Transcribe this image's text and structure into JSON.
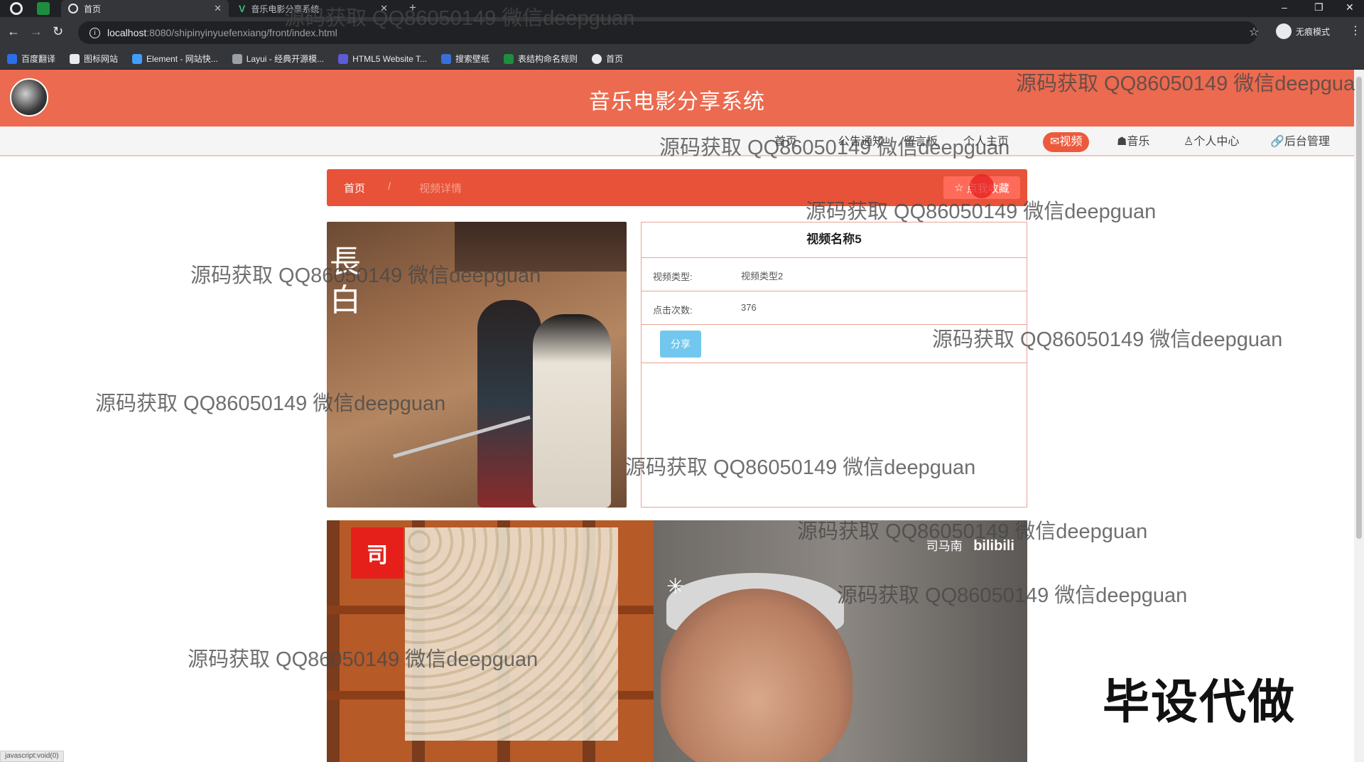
{
  "browser": {
    "tabs": [
      {
        "label": "首页",
        "active": true
      },
      {
        "label": "音乐电影分享系统",
        "active": false
      }
    ],
    "url_host": "localhost",
    "url_path": ":8080/shipinyinyuefenxiang/front/index.html",
    "profile_label": "无痕模式",
    "bookmarks": [
      {
        "label": "百度翻译",
        "color": "#2a6ee8"
      },
      {
        "label": "图标网站",
        "color": "#e8eaed"
      },
      {
        "label": "Element - 网站快...",
        "color": "#409eff"
      },
      {
        "label": "Layui - 经典开源模...",
        "color": "#e8eaed"
      },
      {
        "label": "HTML5 Website T...",
        "color": "#5c5cd6"
      },
      {
        "label": "搜索壁纸",
        "color": "#3b6fd8"
      },
      {
        "label": "表结构命名规则",
        "color": "#1e8e3e"
      },
      {
        "label": "首页",
        "color": "#e8eaed"
      }
    ]
  },
  "site": {
    "title": "音乐电影分享系统",
    "accent": "#ec6a4f",
    "nav": [
      {
        "label": "首页",
        "icon": "home-icon",
        "active": false
      },
      {
        "label": "公告通知",
        "icon": "bell-icon",
        "active": false
      },
      {
        "label": "留言板",
        "icon": "message-icon",
        "active": false
      },
      {
        "label": "个人主页",
        "icon": "user-icon",
        "active": false
      },
      {
        "label": "✉视频",
        "icon": "mail-icon",
        "active": true
      },
      {
        "label": "☗音乐",
        "icon": "music-icon",
        "active": false
      },
      {
        "label": "♙个人中心",
        "icon": "person-icon",
        "active": false
      },
      {
        "label": "🔗后台管理",
        "icon": "link-icon",
        "active": false
      }
    ]
  },
  "breadcrumb": {
    "home": "首页",
    "separator": "/",
    "current": "视频详情",
    "favorite_label": "点我收藏"
  },
  "detail": {
    "title": "视频名称5",
    "rows": [
      {
        "key": "视频类型:",
        "value": "视频类型2"
      },
      {
        "key": "点击次数:",
        "value": "376"
      }
    ],
    "share_label": "分享"
  },
  "video": {
    "badge": "司",
    "brand_name": "司马南",
    "brand_logo": "bilibili"
  },
  "status_bar": "javascript:void(0)",
  "watermarks": [
    "源码获取 QQ86050149 微信deepguan",
    "源码获取 QQ86050149 微信deepgua",
    "源码获取 QQ86050149 微信deepguan",
    "源码获取 QQ86050149 微信deepguan",
    "源码获取 QQ86050149 微信deepguan",
    "源码获取 QQ86050149 微信deepguan",
    "源码获取 QQ86050149 微信deepguan",
    "源码获取 QQ86050149 微信deepguan",
    "源码获取 QQ86050149 微信deepguan",
    "源码获取 QQ86050149 微信deepguan",
    "源码获取 QQ86050149 微信deepguan"
  ],
  "overlay_text": "毕设代做"
}
